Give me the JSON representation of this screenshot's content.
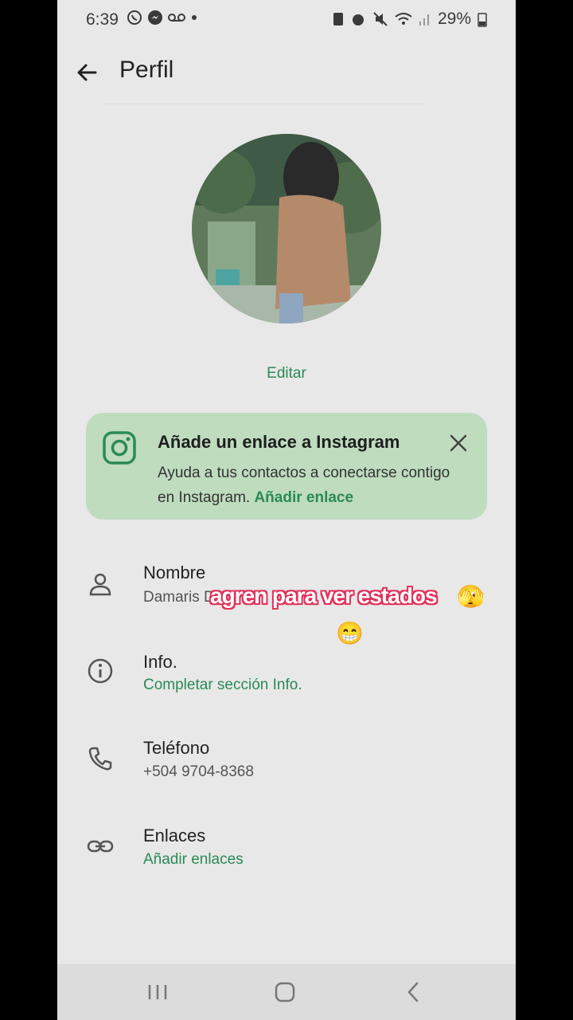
{
  "status_bar": {
    "time": "6:39",
    "battery": "29%"
  },
  "app_bar": {
    "title": "Perfil"
  },
  "profile": {
    "edit_label": "Editar"
  },
  "instagram_card": {
    "title": "Añade un enlace a Instagram",
    "body": "Ayuda a tus contactos a conectarse contigo en Instagram.",
    "link": "Añadir enlace"
  },
  "rows": [
    {
      "title": "Nombre",
      "value": "Damaris Dom",
      "icon": "person-icon"
    },
    {
      "title": "Info.",
      "link": "Completar sección Info.",
      "icon": "info-icon"
    },
    {
      "title": "Teléfono",
      "value": "+504 9704-8368",
      "icon": "phone-icon"
    },
    {
      "title": "Enlaces",
      "link": "Añadir enlaces",
      "icon": "link-icon"
    }
  ],
  "overlay": {
    "caption": "agren para ver estados",
    "emoji1": "🫣",
    "emoji2": "😁"
  },
  "colors": {
    "accent": "#2b8a57",
    "card_bg": "#bfdcbf",
    "screen_bg": "#e8e8e8"
  }
}
